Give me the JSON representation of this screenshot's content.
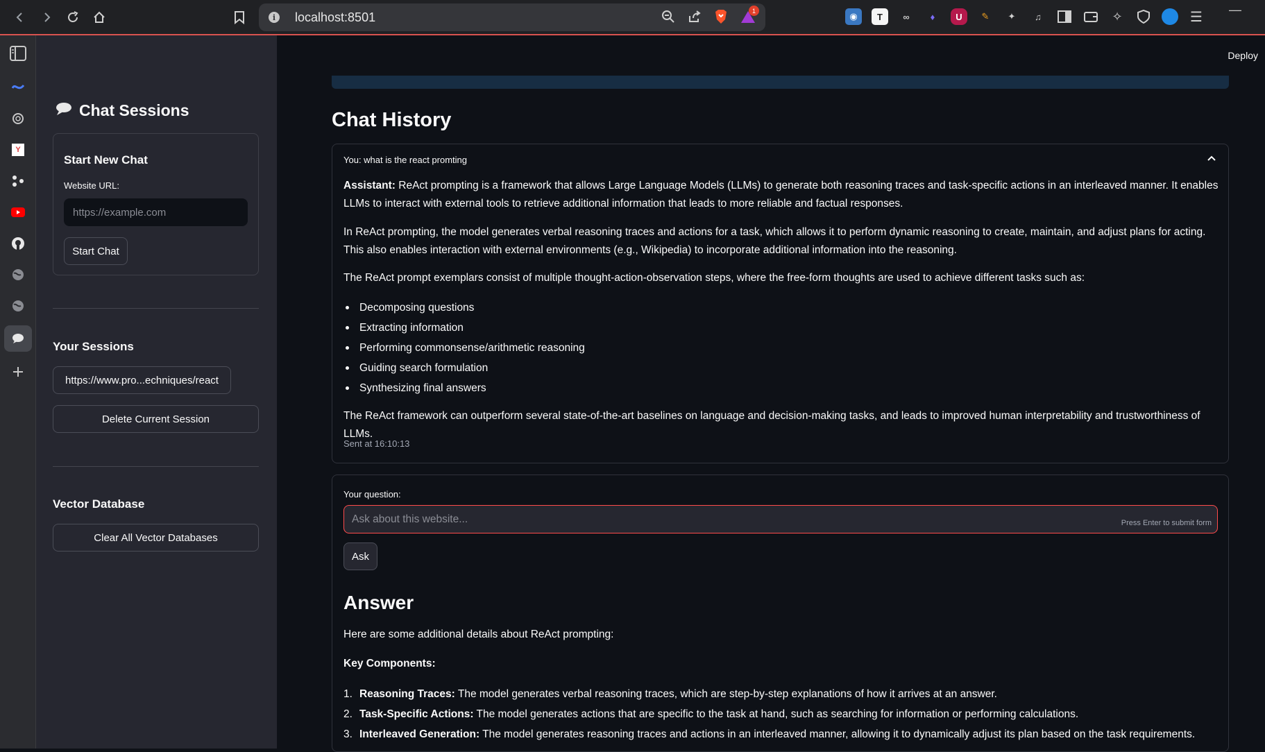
{
  "browser": {
    "url": "localhost:8501",
    "notification_count": "1",
    "extensions": [
      "T",
      "U"
    ]
  },
  "sidebar": {
    "title": "Chat Sessions",
    "new_chat": {
      "heading": "Start New Chat",
      "url_label": "Website URL:",
      "url_placeholder": "https://example.com",
      "start_button": "Start Chat"
    },
    "sessions_heading": "Your Sessions",
    "session_item": "https://www.pro...echniques/react",
    "delete_button": "Delete Current Session",
    "vector_heading": "Vector Database",
    "clear_button": "Clear All Vector Databases"
  },
  "main": {
    "deploy": "Deploy",
    "history_title": "Chat History",
    "expander_title": "You: what is the react promting",
    "assistant_label": "Assistant:",
    "p1": "ReAct prompting is a framework that allows Large Language Models (LLMs) to generate both reasoning traces and task-specific actions in an interleaved manner. It enables LLMs to interact with external tools to retrieve additional information that leads to more reliable and factual responses.",
    "p2": "In ReAct prompting, the model generates verbal reasoning traces and actions for a task, which allows it to perform dynamic reasoning to create, maintain, and adjust plans for acting. This also enables interaction with external environments (e.g., Wikipedia) to incorporate additional information into the reasoning.",
    "p3": "The ReAct prompt exemplars consist of multiple thought-action-observation steps, where the free-form thoughts are used to achieve different tasks such as:",
    "bullets": [
      "Decomposing questions",
      "Extracting information",
      "Performing commonsense/arithmetic reasoning",
      "Guiding search formulation",
      "Synthesizing final answers"
    ],
    "p4": "The ReAct framework can outperform several state-of-the-art baselines on language and decision-making tasks, and leads to improved human interpretability and trustworthiness of LLMs.",
    "sent_at": "Sent at 16:10:13",
    "question_label": "Your question:",
    "question_placeholder": "Ask about this website...",
    "submit_hint": "Press Enter to submit form",
    "ask_button": "Ask",
    "answer_title": "Answer",
    "answer_intro": "Here are some additional details about ReAct prompting:",
    "key_components": "Key Components:",
    "components": [
      {
        "num": "1.",
        "term": "Reasoning Traces:",
        "desc": " The model generates verbal reasoning traces, which are step-by-step explanations of how it arrives at an answer."
      },
      {
        "num": "2.",
        "term": "Task-Specific Actions:",
        "desc": " The model generates actions that are specific to the task at hand, such as searching for information or performing calculations."
      },
      {
        "num": "3.",
        "term": "Interleaved Generation:",
        "desc": " The model generates reasoning traces and actions in an interleaved manner, allowing it to dynamically adjust its plan based on the task requirements."
      }
    ]
  }
}
